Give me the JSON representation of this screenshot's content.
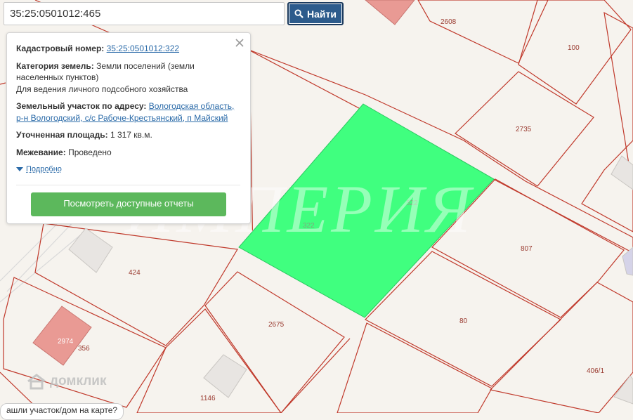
{
  "search": {
    "query": "35:25:0501012:465",
    "button_label": "Найти"
  },
  "popup": {
    "cadastral_label": "Кадастровый номер:",
    "cadastral_value": "35:25:0501012:322",
    "category_label": "Категория земель:",
    "category_value": "Земли поселений (земли населенных пунктов)",
    "usage_value": "Для ведения личного подсобного хозяйства",
    "address_label": "Земельный участок по адресу:",
    "address_value": "Вологодская область, р-н Вологодский, с/с Рабоче-Крестьянский, п Майский",
    "area_label": "Уточненная площадь:",
    "area_value": "1 317 кв.м.",
    "survey_label": "Межевание:",
    "survey_value": "Проведено",
    "details_label": "Подробно",
    "reports_button": "Посмотреть доступные отчеты"
  },
  "map": {
    "plot_labels": [
      "2608",
      "100",
      "2735",
      "322",
      "322",
      "807",
      "424",
      "2675",
      "80",
      "2974",
      "356",
      "1146",
      "406/1"
    ],
    "highlight_color": "#40ff7f",
    "boundary_color": "#c0392b"
  },
  "watermark": "ИМПЕРИЯ",
  "brand": "домклик",
  "bottom_hint": "ашли участок/дом на карте?"
}
